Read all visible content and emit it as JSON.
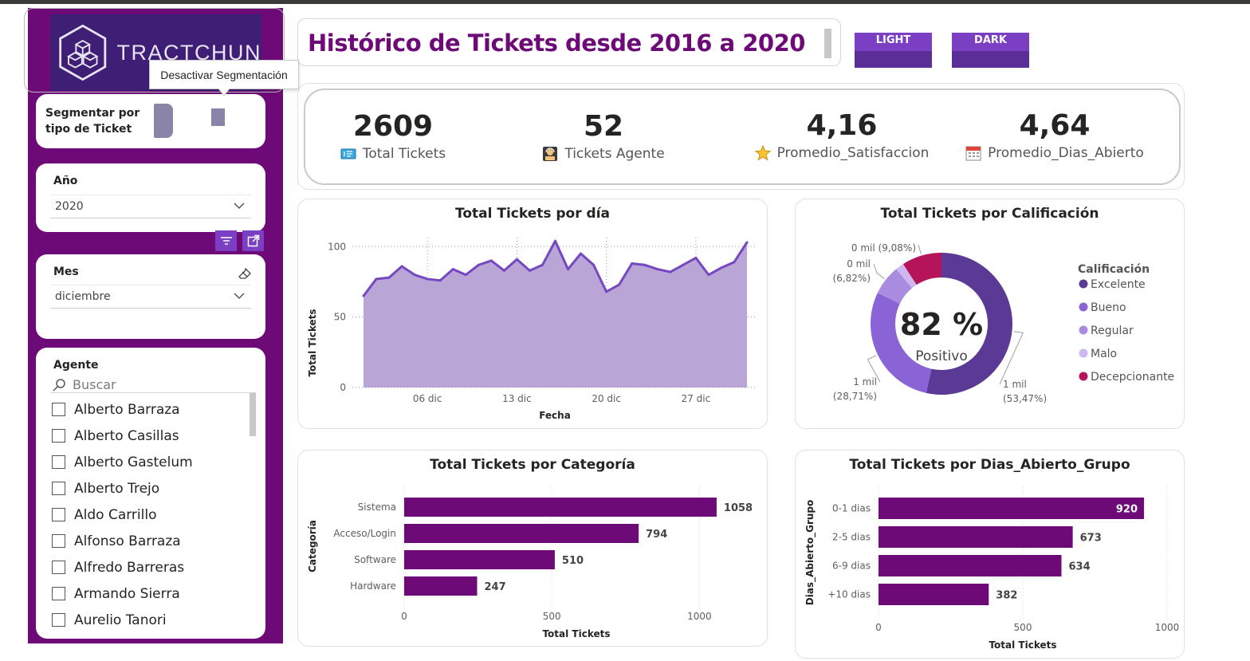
{
  "sidebar": {
    "logo_text": "TRACTCHUN",
    "tooltip": "Desactivar Segmentación",
    "segment_label": "Segmentar por tipo de Ticket",
    "year": {
      "title": "Año",
      "value": "2020"
    },
    "month": {
      "title": "Mes",
      "value": "diciembre"
    },
    "agents": {
      "title": "Agente",
      "search_placeholder": "Buscar",
      "items": [
        "Alberto Barraza",
        "Alberto Casillas",
        "Alberto Gastelum",
        "Alberto Trejo",
        "Aldo Carrillo",
        "Alfonso Barraza",
        "Alfredo Barreras",
        "Armando Sierra",
        "Aurelio Tanori"
      ]
    }
  },
  "header": {
    "title": "Histórico de Tickets desde 2016 a 2020",
    "light_label": "LIGHT",
    "dark_label": "DARK"
  },
  "kpis": [
    {
      "value": "2609",
      "label": "Total Tickets",
      "icon": "ticket-icon"
    },
    {
      "value": "52",
      "label": "Tickets Agente",
      "icon": "agent-icon"
    },
    {
      "value": "4,16",
      "label": "Promedio_Satisfaccion",
      "icon": "star-icon"
    },
    {
      "value": "4,64",
      "label": "Promedio_Dias_Abierto",
      "icon": "calendar-icon"
    }
  ],
  "colors": {
    "purple_dark": "#6d0a78",
    "accent": "#7b3fc4",
    "area": "#b9a6d6",
    "line": "#7548c2"
  },
  "chart_data": [
    {
      "type": "area",
      "title": "Total Tickets por día",
      "xlabel": "Fecha",
      "ylabel": "Total Tickets",
      "x_ticks": [
        "06 dic",
        "13 dic",
        "20 dic",
        "27 dic"
      ],
      "x": [
        "01 dic",
        "02 dic",
        "03 dic",
        "04 dic",
        "05 dic",
        "06 dic",
        "07 dic",
        "08 dic",
        "09 dic",
        "10 dic",
        "11 dic",
        "12 dic",
        "13 dic",
        "14 dic",
        "15 dic",
        "16 dic",
        "17 dic",
        "18 dic",
        "19 dic",
        "20 dic",
        "21 dic",
        "22 dic",
        "23 dic",
        "24 dic",
        "25 dic",
        "26 dic",
        "27 dic",
        "28 dic",
        "29 dic",
        "30 dic",
        "31 dic"
      ],
      "values": [
        65,
        77,
        78,
        86,
        80,
        77,
        76,
        84,
        80,
        87,
        90,
        83,
        91,
        83,
        87,
        104,
        84,
        95,
        87,
        68,
        73,
        88,
        87,
        84,
        82,
        87,
        92,
        80,
        85,
        89,
        103
      ],
      "ylim": [
        0,
        100
      ],
      "y_ticks": [
        0,
        50,
        100
      ]
    },
    {
      "type": "pie",
      "title": "Total Tickets por Calificación",
      "center_value": "82 %",
      "center_label": "Positivo",
      "legend_title": "Calificación",
      "slices": [
        {
          "name": "Excelente",
          "value": 53.47,
          "label": "1 mil\n(53,47%)",
          "color": "#5b3a96"
        },
        {
          "name": "Bueno",
          "value": 28.71,
          "label": "1 mil\n(28,71%)",
          "color": "#8a64d6"
        },
        {
          "name": "Regular",
          "value": 6.82,
          "label": "0 mil\n(6,82%)",
          "color": "#a98be0"
        },
        {
          "name": "Malo",
          "value": 1.92,
          "label": "",
          "color": "#cdb9ef"
        },
        {
          "name": "Decepcionante",
          "value": 9.08,
          "label": "0 mil (9,08%)",
          "color": "#b5145b"
        }
      ]
    },
    {
      "type": "bar",
      "title": "Total Tickets por Categoría",
      "xlabel": "Total Tickets",
      "ylabel": "Categoría",
      "categories": [
        "Sistema",
        "Acceso/Login",
        "Software",
        "Hardware"
      ],
      "values": [
        1058,
        794,
        510,
        247
      ],
      "xlim": [
        0,
        1150
      ],
      "x_ticks": [
        0,
        500,
        1000
      ]
    },
    {
      "type": "bar",
      "title": "Total Tickets por Dias_Abierto_Grupo",
      "xlabel": "Total Tickets",
      "ylabel": "Dias_Abierto_Grupo",
      "categories": [
        "0-1 dias",
        "2-5 dias",
        "6-9 dias",
        "+10 dias"
      ],
      "values": [
        920,
        673,
        634,
        382
      ],
      "xlim": [
        0,
        1000
      ],
      "x_ticks": [
        0,
        500,
        1000
      ]
    }
  ]
}
